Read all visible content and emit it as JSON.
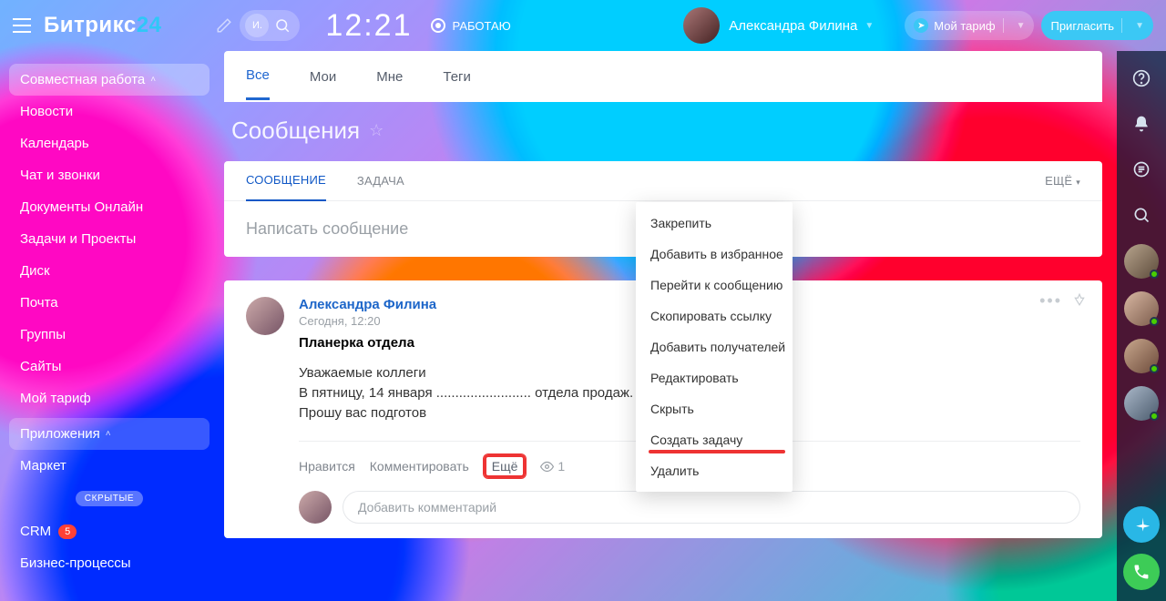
{
  "header": {
    "logo_a": "Битрикс",
    "logo_b": "24",
    "search_initial": "И.",
    "clock": "12:21",
    "status": "РАБОТАЮ",
    "user": "Александра Филина",
    "tariff": "Мой тариф",
    "invite": "Пригласить"
  },
  "sidebar": {
    "head": "Совместная работа",
    "items": [
      "Новости",
      "Календарь",
      "Чат и звонки",
      "Документы Онлайн",
      "Задачи и Проекты",
      "Диск",
      "Почта",
      "Группы",
      "Сайты",
      "Мой тариф"
    ],
    "apps": "Приложения",
    "market": "Маркет",
    "hidden_label": "СКРЫТЫЕ",
    "crm_label": "CRM",
    "crm_badge": "5",
    "bp": "Бизнес-процессы"
  },
  "tabs": {
    "all": "Все",
    "my": "Мои",
    "tome": "Мне",
    "tags": "Теги"
  },
  "page_title": "Сообщения",
  "compose_tabs": {
    "msg": "СООБЩЕНИЕ",
    "task": "ЗАДАЧА",
    "more": "ЕЩЁ"
  },
  "compose_placeholder": "Написать сообщение",
  "post": {
    "author": "Александра Филина",
    "time": "Сегодня, 12:20",
    "title": "Планерка отдела",
    "body_l1": "Уважаемые коллеги",
    "body_l2": "В пятницу, 14 января ......................... отдела продаж.",
    "body_l3": "Прошу вас подготов",
    "like": "Нравится",
    "comment": "Комментировать",
    "more": "Ещё",
    "views": "1",
    "comment_ph": "Добавить комментарий"
  },
  "dropdown": [
    "Закрепить",
    "Добавить в избранное",
    "Перейти к сообщению",
    "Скопировать ссылку",
    "Добавить получателей",
    "Редактировать",
    "Скрыть",
    "Создать задачу",
    "Удалить"
  ]
}
